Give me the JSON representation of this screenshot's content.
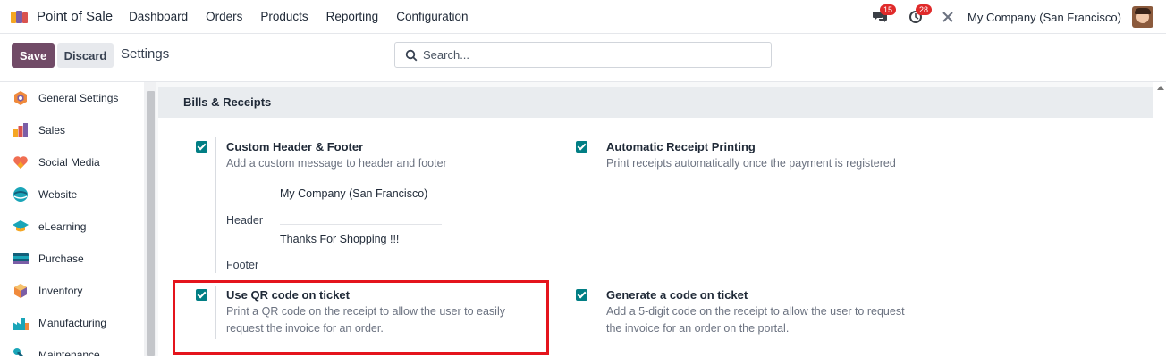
{
  "navbar": {
    "app_name": "Point of Sale",
    "menu": [
      "Dashboard",
      "Orders",
      "Products",
      "Reporting",
      "Configuration"
    ],
    "messages_badge": "15",
    "activities_badge": "28",
    "company": "My Company (San Francisco)"
  },
  "control": {
    "save_label": "Save",
    "discard_label": "Discard",
    "breadcrumb": "Settings",
    "search_placeholder": "Search..."
  },
  "sidebar": {
    "items": [
      {
        "label": "General Settings",
        "icon": "general-settings-icon"
      },
      {
        "label": "Sales",
        "icon": "sales-icon"
      },
      {
        "label": "Social Media",
        "icon": "social-media-icon"
      },
      {
        "label": "Website",
        "icon": "website-icon"
      },
      {
        "label": "eLearning",
        "icon": "elearning-icon"
      },
      {
        "label": "Purchase",
        "icon": "purchase-icon"
      },
      {
        "label": "Inventory",
        "icon": "inventory-icon"
      },
      {
        "label": "Manufacturing",
        "icon": "manufacturing-icon"
      },
      {
        "label": "Maintenance",
        "icon": "maintenance-icon"
      }
    ]
  },
  "section": {
    "title": "Bills & Receipts",
    "settings": {
      "custom_header_footer": {
        "title": "Custom Header & Footer",
        "description": "Add a custom message to header and footer",
        "checked": true,
        "header_label": "Header",
        "header_value": "My Company (San Francisco)",
        "footer_label": "Footer",
        "footer_value": "Thanks For Shopping !!!"
      },
      "automatic_receipt_printing": {
        "title": "Automatic Receipt Printing",
        "description": "Print receipts automatically once the payment is registered",
        "checked": true
      },
      "qr_code": {
        "title": "Use QR code on ticket",
        "description_line1": "Print a QR code on the receipt to allow the user to easily",
        "description_line2": "request the invoice for an order.",
        "checked": true
      },
      "generate_code": {
        "title": "Generate a code on ticket",
        "description_line1": "Add a 5-digit code on the receipt to allow the user to request",
        "description_line2": "the invoice for an order on the portal.",
        "checked": true
      }
    }
  },
  "colors": {
    "brand": "#714b67",
    "checkbox": "#017e84",
    "highlight": "#e4141c",
    "badge": "#e02a2a"
  }
}
